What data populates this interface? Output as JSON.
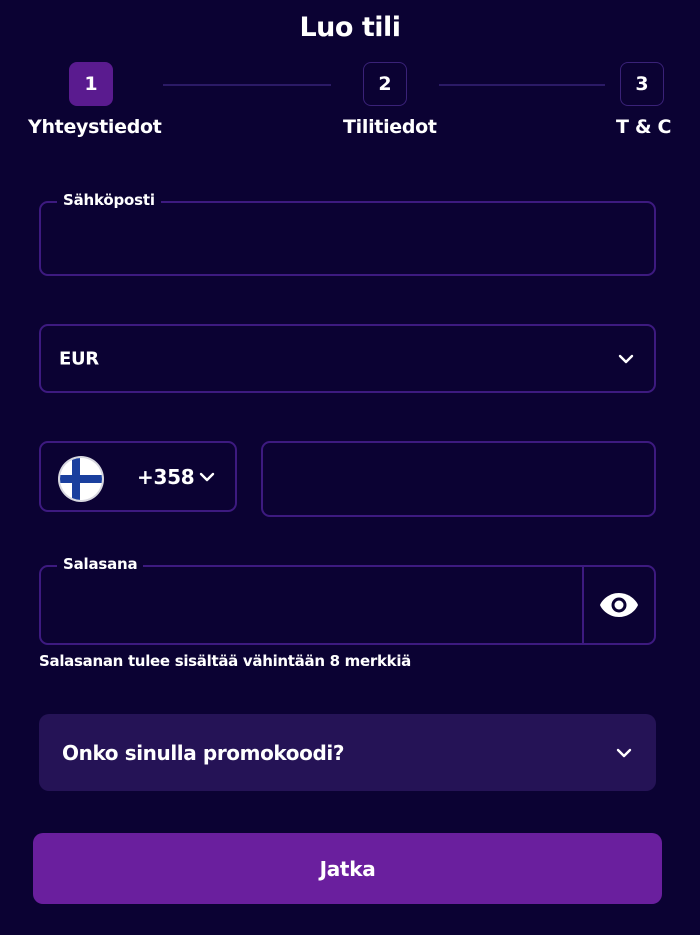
{
  "header": {
    "title": "Luo tili"
  },
  "steps": [
    {
      "number": "1",
      "label": "Yhteystiedot",
      "active": true
    },
    {
      "number": "2",
      "label": "Tilitiedot",
      "active": false
    },
    {
      "number": "3",
      "label": "T & C",
      "active": false
    }
  ],
  "email": {
    "label": "Sähköposti",
    "value": ""
  },
  "currency": {
    "selected": "EUR",
    "icon": "chevron-down-icon"
  },
  "phone": {
    "country_flag": "finland-flag-icon",
    "code": "+358",
    "number": ""
  },
  "password": {
    "label": "Salasana",
    "value": "",
    "toggle_icon": "eye-icon",
    "helper": "Salasanan tulee sisältää vähintään 8 merkkiä"
  },
  "promo": {
    "label": "Onko sinulla promokoodi?",
    "icon": "chevron-down-icon"
  },
  "submit": {
    "label": "Jatka"
  },
  "colors": {
    "background": "#0b0233",
    "accent": "#6a1f9e",
    "border": "#3d1a80",
    "panel": "#251356"
  }
}
